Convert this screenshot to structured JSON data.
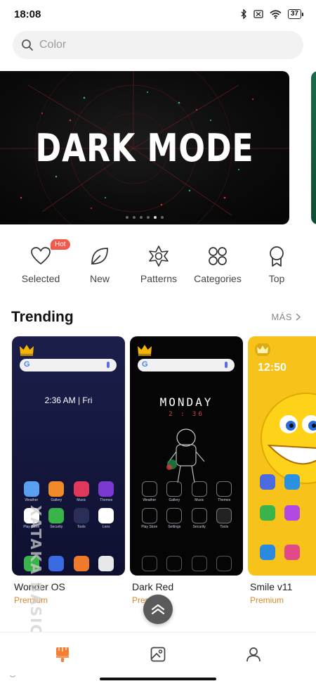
{
  "status_bar": {
    "time": "18:08",
    "battery": "37",
    "icons": [
      "bluetooth-icon",
      "sim-icon",
      "wifi-icon",
      "battery-icon"
    ]
  },
  "search": {
    "placeholder": "Color"
  },
  "banner": {
    "title": "DARK MODE",
    "dot_count": 6,
    "active_dot": 4
  },
  "categories": [
    {
      "label": "Selected",
      "icon": "heart-icon",
      "badge": "Hot"
    },
    {
      "label": "New",
      "icon": "leaf-icon"
    },
    {
      "label": "Patterns",
      "icon": "pattern-icon"
    },
    {
      "label": "Categories",
      "icon": "clover-icon"
    },
    {
      "label": "Top",
      "icon": "ribbon-icon"
    }
  ],
  "trending": {
    "title": "Trending",
    "more_label": "MÁS",
    "items": [
      {
        "name": "Wonder OS",
        "tier": "Premium",
        "clock": "2:36 AM | Fri",
        "apps": [
          "Weather",
          "Gallery",
          "Music",
          "Themes",
          "Play Store",
          "Security",
          "Tools",
          "Lens"
        ]
      },
      {
        "name": "Dark Red",
        "tier": "Premium",
        "headline": "MONDAY",
        "time": "2 : 36",
        "apps": [
          "Weather",
          "Gallery",
          "Music",
          "Themes",
          "Play Store",
          "Settings",
          "Security",
          "Tools"
        ]
      },
      {
        "name": "Smile v11",
        "tier": "Premium",
        "clock": "12:50"
      }
    ]
  },
  "watermark": "XATAKA BASICS",
  "bottom_nav": [
    {
      "name": "themes-tab",
      "icon": "brush-icon",
      "active": true
    },
    {
      "name": "wallpapers-tab",
      "icon": "image-icon",
      "active": false
    },
    {
      "name": "profile-tab",
      "icon": "person-icon",
      "active": false
    }
  ],
  "colors": {
    "accent": "#f47e32",
    "premium": "#d9892a",
    "hot_badge": "#f05a4a"
  }
}
